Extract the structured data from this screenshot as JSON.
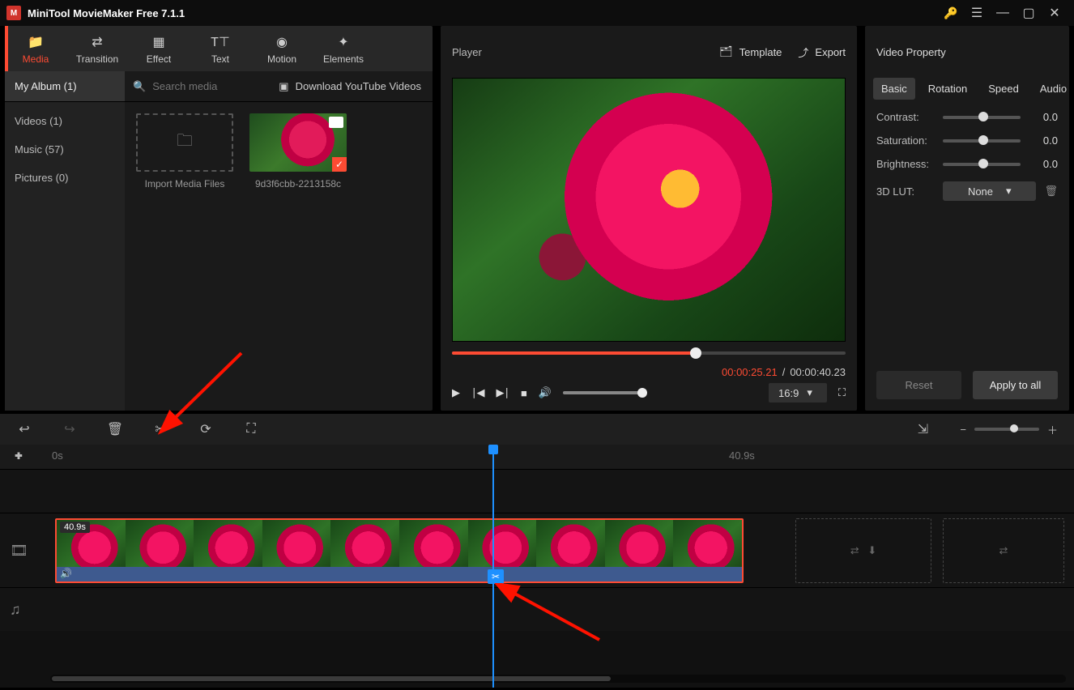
{
  "app": {
    "title": "MiniTool MovieMaker Free 7.1.1"
  },
  "tabs": {
    "media": "Media",
    "transition": "Transition",
    "effect": "Effect",
    "text": "Text",
    "motion": "Motion",
    "elements": "Elements"
  },
  "media": {
    "album_label": "My Album (1)",
    "search_placeholder": "Search media",
    "download_yt": "Download YouTube Videos",
    "side": {
      "videos": "Videos (1)",
      "music": "Music (57)",
      "pictures": "Pictures (0)"
    },
    "import_label": "Import Media Files",
    "clip_name": "9d3f6cbb-2213158c"
  },
  "player": {
    "title": "Player",
    "template": "Template",
    "export": "Export",
    "time_current": "00:00:25.21",
    "time_sep": "/",
    "time_total": "00:00:40.23",
    "aspect": "16:9"
  },
  "props": {
    "title": "Video Property",
    "tabs": {
      "basic": "Basic",
      "rotation": "Rotation",
      "speed": "Speed",
      "audio": "Audio"
    },
    "contrast_label": "Contrast:",
    "contrast_val": "0.0",
    "saturation_label": "Saturation:",
    "saturation_val": "0.0",
    "brightness_label": "Brightness:",
    "brightness_val": "0.0",
    "lut_label": "3D LUT:",
    "lut_val": "None",
    "reset": "Reset",
    "apply": "Apply to all"
  },
  "timeline": {
    "start": "0s",
    "end": "40.9s",
    "clip_duration": "40.9s"
  }
}
